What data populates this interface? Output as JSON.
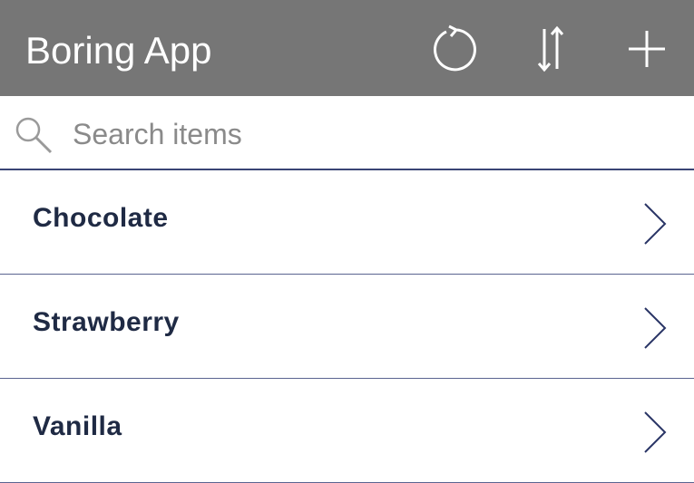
{
  "header": {
    "title": "Boring App",
    "background_color": "#767676",
    "actions": [
      {
        "name": "refresh",
        "icon": "refresh-icon"
      },
      {
        "name": "sort",
        "icon": "sort-icon"
      },
      {
        "name": "add",
        "icon": "add-icon"
      }
    ]
  },
  "search": {
    "placeholder": "Search items",
    "value": "",
    "icon": "search-icon"
  },
  "list": {
    "items": [
      {
        "label": "Chocolate",
        "icon": "chevron-right-icon"
      },
      {
        "label": "Strawberry",
        "icon": "chevron-right-icon"
      },
      {
        "label": "Vanilla",
        "icon": "chevron-right-icon"
      }
    ],
    "text_color": "#1f2a44",
    "divider_color": "#3a4575"
  }
}
